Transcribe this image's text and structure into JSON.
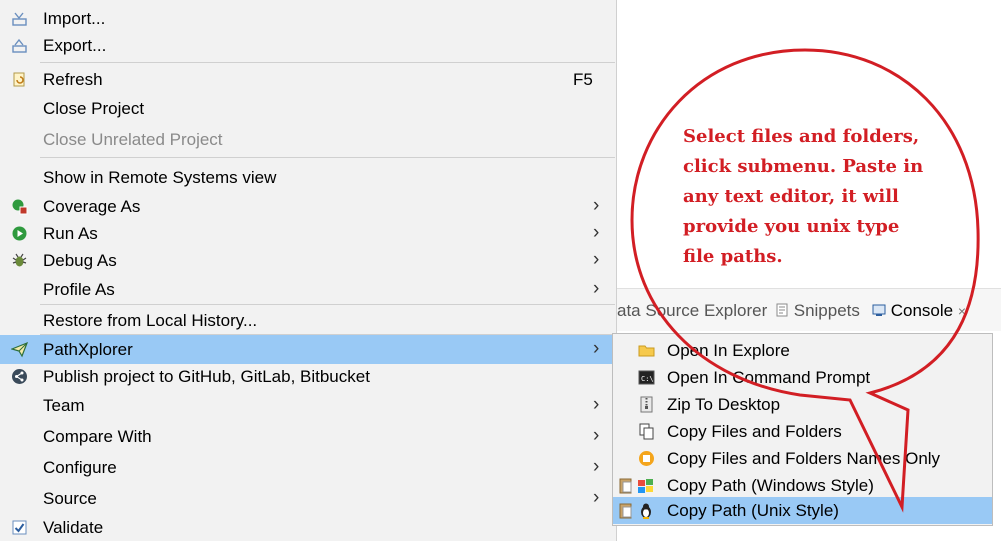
{
  "menu": {
    "items": [
      {
        "id": "import",
        "label": "Import...",
        "icon": "import-icon"
      },
      {
        "id": "export",
        "label": "Export...",
        "icon": "export-icon"
      },
      {
        "id": "refresh",
        "label": "Refresh",
        "accelerator": "F5",
        "icon": "refresh-icon"
      },
      {
        "id": "close-project",
        "label": "Close Project"
      },
      {
        "id": "close-unrelated",
        "label": "Close Unrelated Project",
        "disabled": true
      },
      {
        "id": "show-remote",
        "label": "Show in Remote Systems view"
      },
      {
        "id": "coverage-as",
        "label": "Coverage As",
        "submenu": true,
        "icon": "coverage-icon"
      },
      {
        "id": "run-as",
        "label": "Run As",
        "submenu": true,
        "icon": "run-icon"
      },
      {
        "id": "debug-as",
        "label": "Debug As",
        "submenu": true,
        "icon": "debug-bug-icon"
      },
      {
        "id": "profile-as",
        "label": "Profile As",
        "submenu": true
      },
      {
        "id": "restore-history",
        "label": "Restore from Local History..."
      },
      {
        "id": "pathxplorer",
        "label": "PathXplorer",
        "submenu": true,
        "highlighted": true,
        "icon": "paper-plane-icon"
      },
      {
        "id": "publish",
        "label": "Publish project to GitHub, GitLab, Bitbucket",
        "icon": "share-icon"
      },
      {
        "id": "team",
        "label": "Team",
        "submenu": true
      },
      {
        "id": "compare-with",
        "label": "Compare With",
        "submenu": true
      },
      {
        "id": "configure",
        "label": "Configure",
        "submenu": true
      },
      {
        "id": "source",
        "label": "Source",
        "submenu": true
      },
      {
        "id": "validate",
        "label": "Validate",
        "icon": "checkbox-icon"
      }
    ],
    "submenu_arrow": "›"
  },
  "submenu": {
    "items": [
      {
        "label": "Open In Explore",
        "icon": "folder-icon"
      },
      {
        "label": "Open In Command Prompt",
        "icon": "terminal-icon"
      },
      {
        "label": "Zip To Desktop",
        "icon": "zip-icon"
      },
      {
        "label": "Copy Files and Folders",
        "icon": "copy-icon"
      },
      {
        "label": "Copy Files and Folders Names Only",
        "icon": "names-icon"
      },
      {
        "label": "Copy Path (Windows Style)",
        "icon": "windows-clipboard-icon"
      },
      {
        "label": "Copy Path (Unix Style)",
        "icon": "linux-clipboard-icon",
        "highlighted": true
      }
    ]
  },
  "tabs": {
    "data_source": "ata Source Explorer",
    "snippets": "Snippets",
    "console": "Console",
    "close": "×"
  },
  "annotation": {
    "text_lines": [
      "Select files and folders,",
      "click submenu. Paste in",
      "any text editor, it will",
      "provide you unix type",
      "file paths."
    ],
    "color": "#d21e24"
  },
  "colors": {
    "highlight": "#99c9f5",
    "menu_bg": "#f2f2f2"
  }
}
